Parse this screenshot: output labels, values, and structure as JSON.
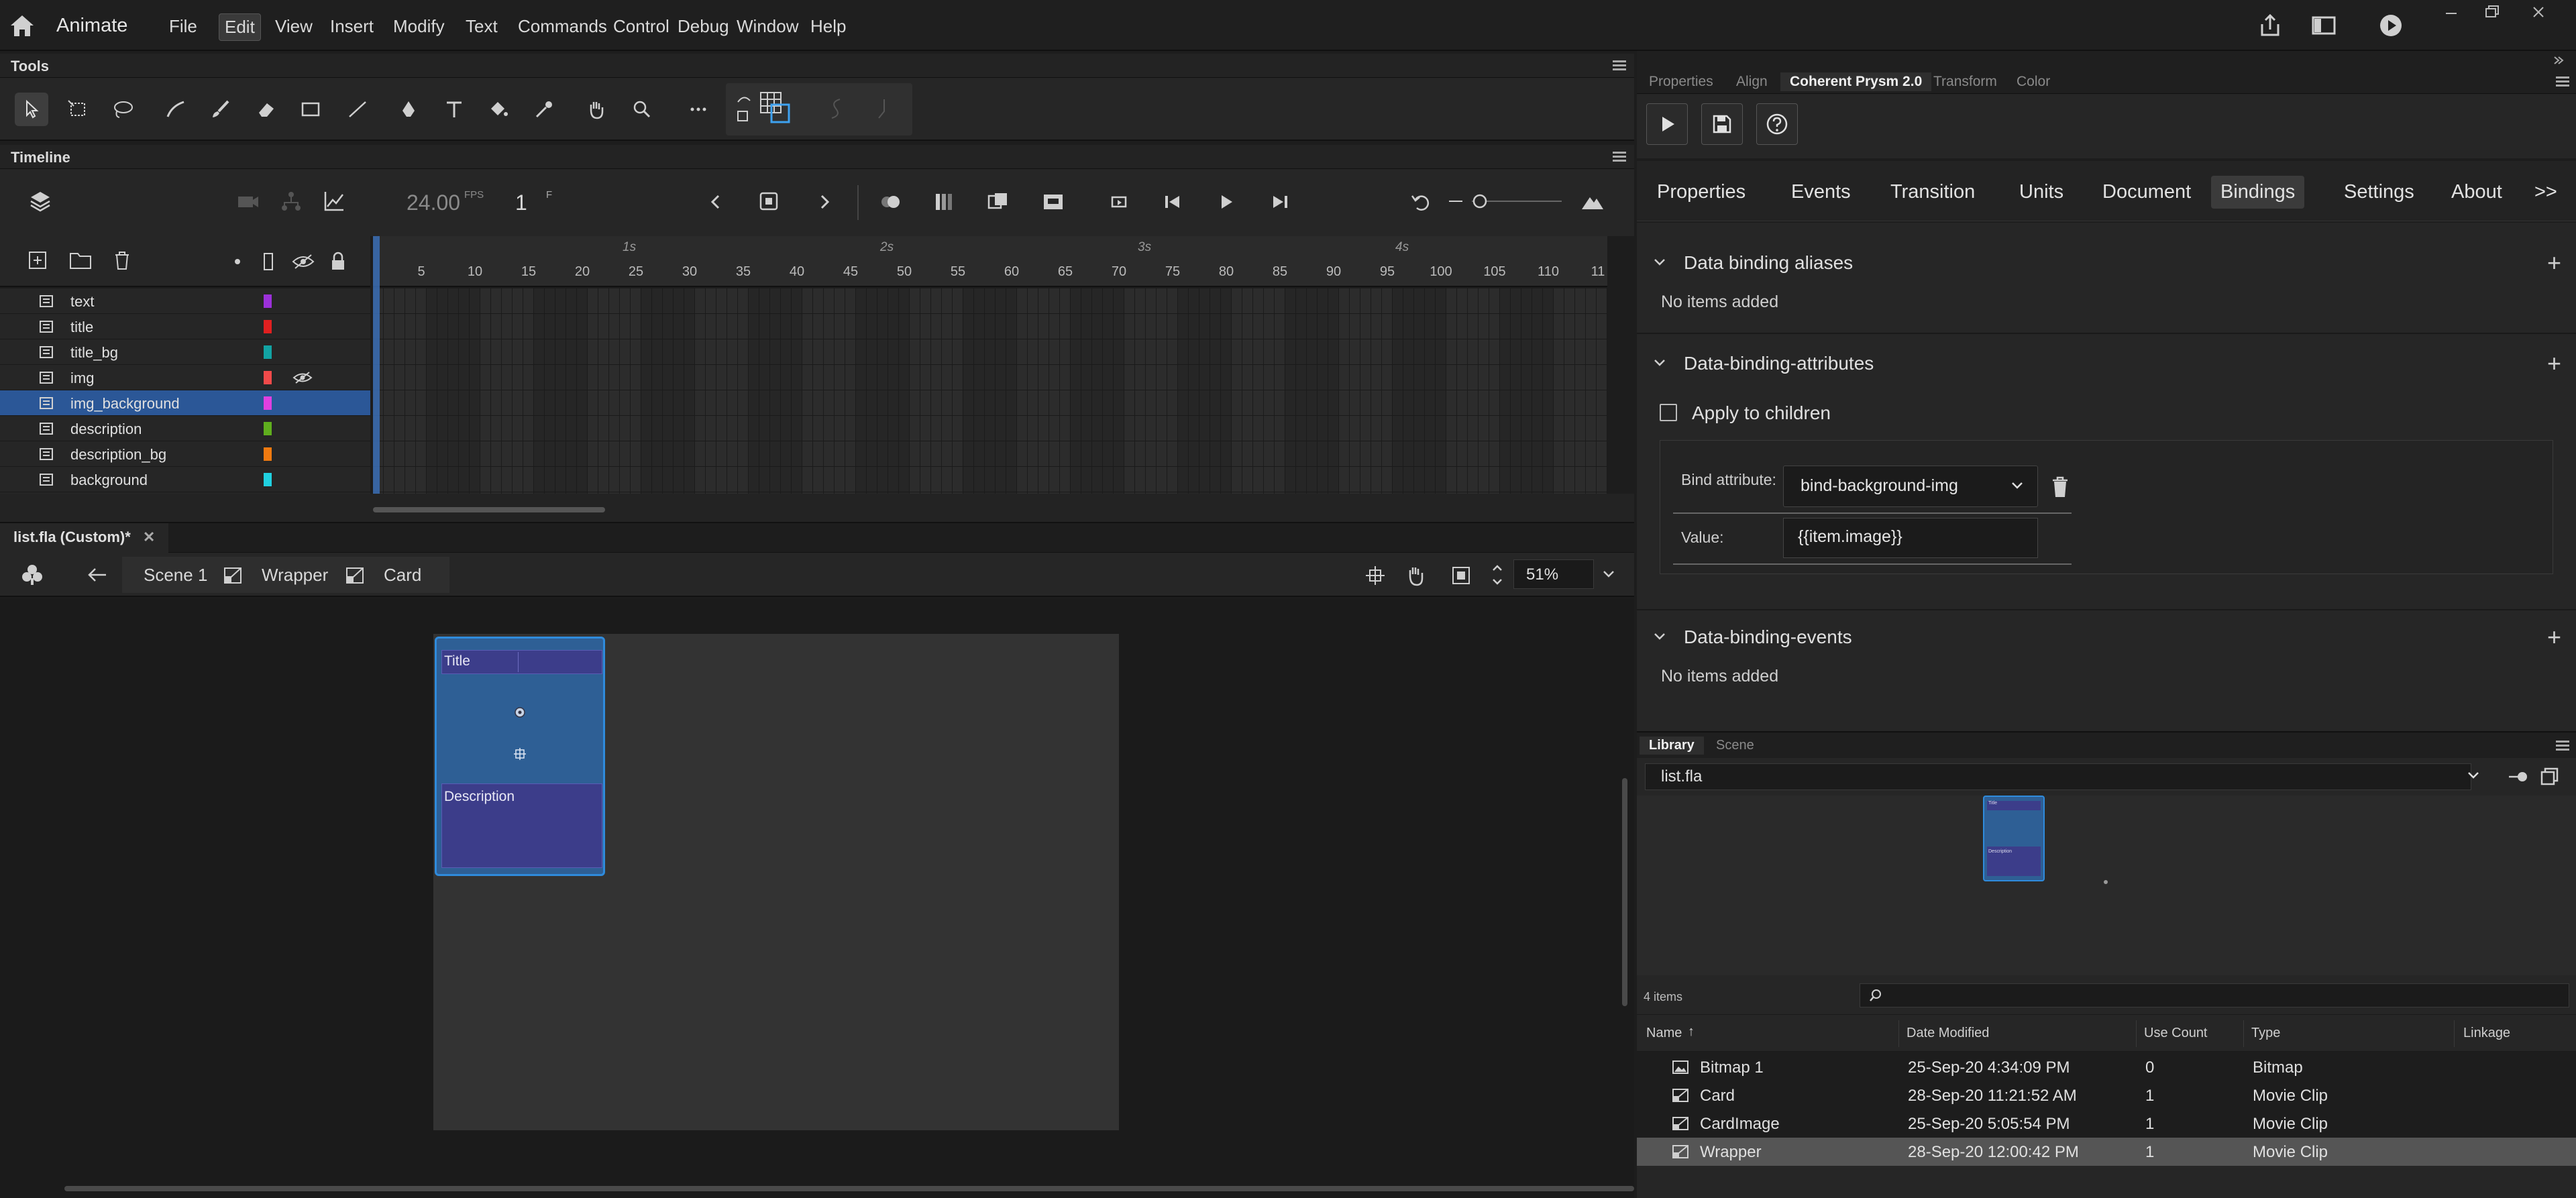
{
  "app": {
    "name": "Animate"
  },
  "menu": [
    "File",
    "Edit",
    "View",
    "Insert",
    "Modify",
    "Text",
    "Commands",
    "Control",
    "Debug",
    "Window",
    "Help"
  ],
  "panels": {
    "tools": "Tools",
    "timeline": "Timeline"
  },
  "timeline": {
    "fps": "24.00",
    "fps_unit": "FPS",
    "frame": "1",
    "frame_unit": "F",
    "seconds": [
      "1s",
      "2s",
      "3s",
      "4s"
    ],
    "ruler": [
      "5",
      "10",
      "15",
      "20",
      "25",
      "30",
      "35",
      "40",
      "45",
      "50",
      "55",
      "60",
      "65",
      "70",
      "75",
      "80",
      "85",
      "90",
      "95",
      "100",
      "105",
      "110",
      "11"
    ],
    "layers": [
      {
        "name": "text",
        "color": "#9b30d9"
      },
      {
        "name": "title",
        "color": "#e02020"
      },
      {
        "name": "title_bg",
        "color": "#12a3a3"
      },
      {
        "name": "img",
        "color": "#f04a4a"
      },
      {
        "name": "img_background",
        "color": "#e040e0",
        "selected": true
      },
      {
        "name": "description",
        "color": "#5fae1e"
      },
      {
        "name": "description_bg",
        "color": "#f07a10"
      },
      {
        "name": "background",
        "color": "#20d0e0"
      }
    ]
  },
  "document": {
    "tab": "list.fla (Custom)*",
    "breadcrumbs": [
      "Scene 1",
      "Wrapper",
      "Card"
    ],
    "zoom": "51%"
  },
  "stage": {
    "card_title": "Title",
    "card_description": "Description"
  },
  "right_panel": {
    "tabs": [
      "Properties",
      "Align",
      "Coherent Prysm 2.0",
      "Transform",
      "Color"
    ],
    "active_tab": "Coherent Prysm 2.0",
    "nav": [
      "Properties",
      "Events",
      "Transition",
      "Units",
      "Document",
      "Bindings",
      "Settings",
      "About"
    ],
    "nav_more": ">>",
    "active_nav": "Bindings",
    "sections": {
      "aliases": {
        "title": "Data binding aliases",
        "note": "No items added"
      },
      "attributes": {
        "title": "Data-binding-attributes",
        "apply_children": "Apply to children",
        "bind_label": "Bind attribute:",
        "bind_value": "bind-background-img",
        "value_label": "Value:",
        "value": "{{item.image}}"
      },
      "events": {
        "title": "Data-binding-events",
        "note": "No items added"
      }
    }
  },
  "library": {
    "tabs": [
      "Library",
      "Scene"
    ],
    "file": "list.fla",
    "count": "4 items",
    "columns": [
      "Name",
      "Date Modified",
      "Use Count",
      "Type",
      "Linkage"
    ],
    "thumb": {
      "title": "Title",
      "description": "Description"
    },
    "items": [
      {
        "name": "Bitmap 1",
        "date": "25-Sep-20 4:34:09 PM",
        "count": "0",
        "type": "Bitmap",
        "icon": "bitmap-icon"
      },
      {
        "name": "Card",
        "date": "28-Sep-20 11:21:52 AM",
        "count": "1",
        "type": "Movie Clip",
        "icon": "movie-clip-icon"
      },
      {
        "name": "CardImage",
        "date": "25-Sep-20 5:05:54 PM",
        "count": "1",
        "type": "Movie Clip",
        "icon": "movie-clip-icon"
      },
      {
        "name": "Wrapper",
        "date": "28-Sep-20 12:00:42 PM",
        "count": "1",
        "type": "Movie Clip",
        "icon": "movie-clip-icon",
        "selected": true
      }
    ]
  }
}
